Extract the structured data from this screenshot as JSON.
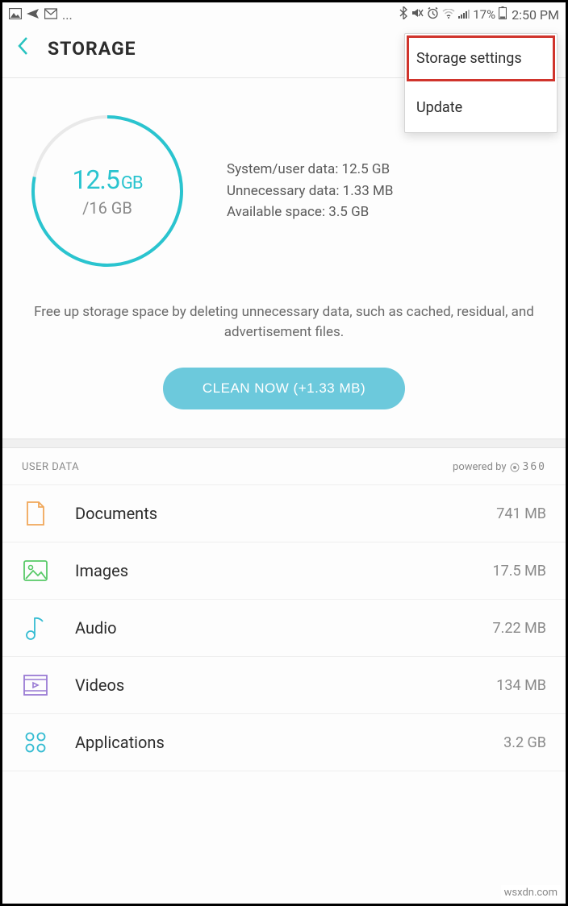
{
  "statusbar": {
    "battery_pct": "17%",
    "time": "2:50 PM",
    "dots": "..."
  },
  "header": {
    "title": "STORAGE"
  },
  "menu": {
    "items": [
      {
        "label": "Storage settings",
        "highlighted": true
      },
      {
        "label": "Update",
        "highlighted": false
      }
    ]
  },
  "ring": {
    "used_value": "12.5",
    "used_unit": "GB",
    "total": "/16 GB",
    "progress_fraction": 0.78
  },
  "info": {
    "line1": "System/user data: 12.5 GB",
    "line2": "Unnecessary data: 1.33 MB",
    "line3": "Available space: 3.5 GB"
  },
  "hint": "Free up storage space by deleting unnecessary data, such as cached, residual, and advertisement files.",
  "clean_btn": "CLEAN NOW (+1.33 MB)",
  "section": {
    "title": "USER DATA",
    "powered": "powered by",
    "brand": "360"
  },
  "categories": [
    {
      "icon": "doc",
      "label": "Documents",
      "size": "741 MB",
      "color": "#f0a75a"
    },
    {
      "icon": "image",
      "label": "Images",
      "size": "17.5 MB",
      "color": "#58c968"
    },
    {
      "icon": "audio",
      "label": "Audio",
      "size": "7.22 MB",
      "color": "#35bcd2"
    },
    {
      "icon": "video",
      "label": "Videos",
      "size": "134 MB",
      "color": "#9a7bd4"
    },
    {
      "icon": "apps",
      "label": "Applications",
      "size": "3.2 GB",
      "color": "#35bcd2"
    }
  ],
  "watermark": "wsxdn.com"
}
